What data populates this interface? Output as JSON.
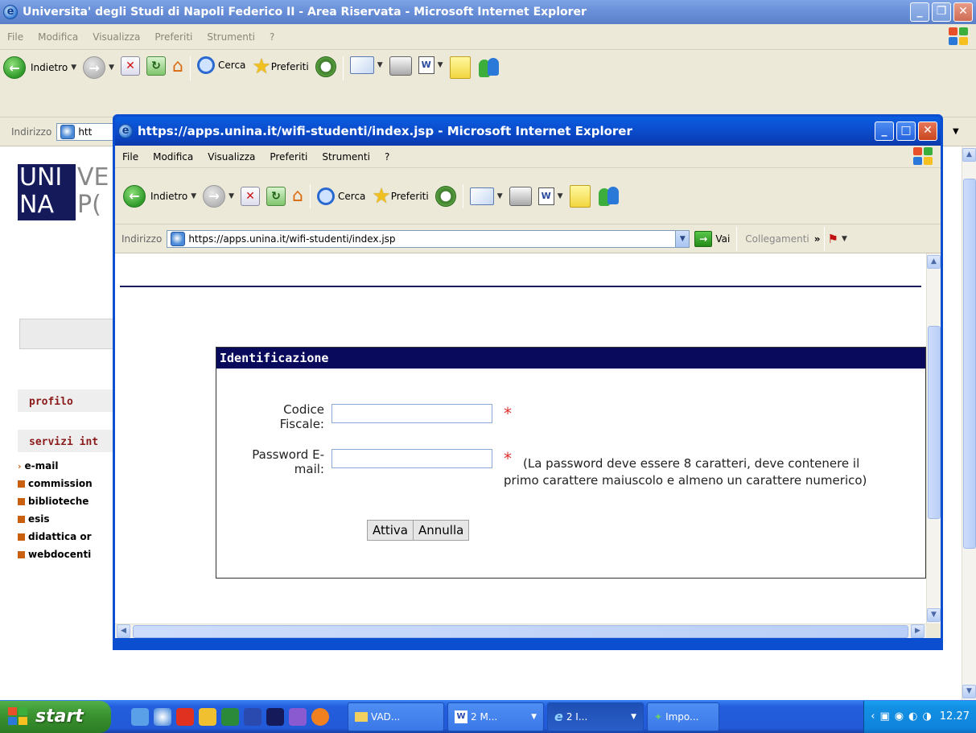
{
  "outer_window": {
    "title": "Universita' degli Studi di Napoli Federico II - Area Riservata - Microsoft Internet Explorer",
    "menu": [
      "File",
      "Modifica",
      "Visualizza",
      "Preferiti",
      "Strumenti",
      "?"
    ],
    "toolbar": {
      "back": "Indietro",
      "search": "Cerca",
      "favorites": "Preferiti"
    },
    "address_label": "Indirizzo",
    "address_value": "htt"
  },
  "background_page": {
    "logo_top": "UNI",
    "logo_top_cut": "VE",
    "logo_bottom": "NA",
    "logo_bottom_cut": "P(",
    "section_profile": "profilo",
    "section_services": "servizi int",
    "links": [
      "e-mail",
      "commission",
      "biblioteche",
      "esis",
      "didattica or",
      "webdocenti"
    ]
  },
  "popup": {
    "title": "https://apps.unina.it/wifi-studenti/index.jsp - Microsoft Internet Explorer",
    "menu": [
      "File",
      "Modifica",
      "Visualizza",
      "Preferiti",
      "Strumenti",
      "?"
    ],
    "toolbar": {
      "back": "Indietro",
      "search": "Cerca",
      "favorites": "Preferiti"
    },
    "address_label": "Indirizzo",
    "address_value": "https://apps.unina.it/wifi-studenti/index.jsp",
    "go_label": "Vai",
    "links_label": "Collegamenti",
    "links_chevron": "»"
  },
  "form": {
    "heading": "Identificazione",
    "codice_label_1": "Codice",
    "codice_label_2": "Fiscale:",
    "codice_value": "",
    "password_label_1": "Password E-",
    "password_label_2": "mail:",
    "password_value": "",
    "required_mark": "*",
    "password_note": "(La password deve essere 8 caratteri, deve contenere il primo carattere maiuscolo e almeno un carattere numerico)",
    "submit_label": "Attiva",
    "cancel_label": "Annulla"
  },
  "taskbar": {
    "start_label": "start",
    "tasks": [
      "VAD...",
      "2 M...",
      "2 I...",
      "Impo..."
    ],
    "clock": "12.27"
  },
  "colors": {
    "form_header": "#0a0a5c",
    "required_star": "#e23030",
    "section_heading": "#8b1a1a",
    "link_bullet": "#c86010",
    "xp_titlebar": "#0b4fd0"
  }
}
